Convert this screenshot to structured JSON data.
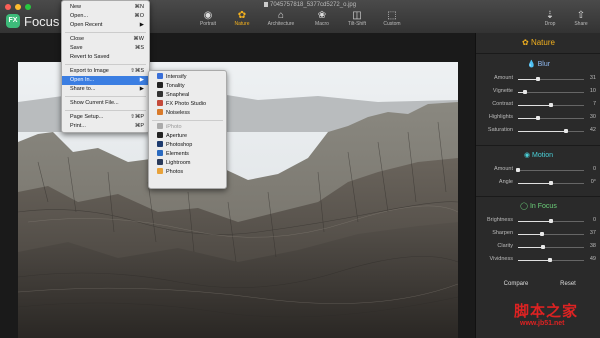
{
  "window": {
    "traffic_lights": [
      "#fc5f57",
      "#fdbc2e",
      "#28c840"
    ],
    "app_name": "Focus",
    "logo_text": "FX",
    "document_title": "7045757818_5377cd5272_o.jpg"
  },
  "toolbar": {
    "presets": [
      {
        "label": "Portrait",
        "icon": "portrait-icon",
        "glyph": "◉"
      },
      {
        "label": "Nature",
        "icon": "nature-icon",
        "glyph": "✿",
        "active": true
      },
      {
        "label": "Architecture",
        "icon": "architecture-icon",
        "glyph": "⌂"
      },
      {
        "label": "Macro",
        "icon": "macro-icon",
        "glyph": "❀"
      },
      {
        "label": "Tilt-Shift",
        "icon": "tilt-shift-icon",
        "glyph": "◫"
      },
      {
        "label": "Custom",
        "icon": "custom-icon",
        "glyph": "⬚"
      }
    ],
    "right": [
      {
        "label": "Drop",
        "icon": "drop-icon",
        "glyph": "⇣"
      },
      {
        "label": "Share",
        "icon": "share-icon",
        "glyph": "⇧"
      }
    ]
  },
  "file_menu": {
    "items": [
      {
        "label": "New",
        "shortcut": "⌘N"
      },
      {
        "label": "Open...",
        "shortcut": "⌘O"
      },
      {
        "label": "Open Recent",
        "shortcut": "▶"
      },
      {
        "sep": true
      },
      {
        "label": "Close",
        "shortcut": "⌘W"
      },
      {
        "label": "Save",
        "shortcut": "⌘S"
      },
      {
        "label": "Revert to Saved",
        "shortcut": ""
      },
      {
        "sep": true
      },
      {
        "label": "Export to Image",
        "shortcut": "⇧⌘S"
      },
      {
        "label": "Open In...",
        "shortcut": "▶",
        "highlighted": true
      },
      {
        "label": "Share to...",
        "shortcut": "▶"
      },
      {
        "sep": true
      },
      {
        "label": "Show Current File...",
        "shortcut": ""
      },
      {
        "sep": true
      },
      {
        "label": "Page Setup...",
        "shortcut": "⇧⌘P"
      },
      {
        "label": "Print...",
        "shortcut": "⌘P"
      }
    ]
  },
  "open_in_menu": {
    "items": [
      {
        "label": "Intensify",
        "color": "#3a6fd8"
      },
      {
        "label": "Tonality",
        "color": "#222222"
      },
      {
        "label": "Snapheal",
        "color": "#333333"
      },
      {
        "label": "FX Photo Studio",
        "color": "#c44a3a"
      },
      {
        "label": "Noiseless",
        "color": "#d97a2a"
      },
      {
        "sep": true
      },
      {
        "label": "iPhoto",
        "color": "#aaaaaa",
        "disabled": true
      },
      {
        "label": "Aperture",
        "color": "#222222"
      },
      {
        "label": "Photoshop",
        "color": "#1d3b6e"
      },
      {
        "label": "Elements",
        "color": "#2a6ac0"
      },
      {
        "label": "Lightroom",
        "color": "#2a3a5a"
      },
      {
        "label": "Photos",
        "color": "#e8a23a"
      }
    ]
  },
  "sidebar": {
    "title": "Nature",
    "sections": [
      {
        "title": "Blur",
        "color": "#8fb8f0",
        "icon": "droplet-icon",
        "glyph": "💧",
        "rows": [
          {
            "label": "Amount",
            "value": "31",
            "fraction": 0.31
          },
          {
            "label": "Vignette",
            "value": "10",
            "fraction": 0.1
          },
          {
            "label": "Contrast",
            "value": "7",
            "fraction": 0.5
          },
          {
            "label": "Highlights",
            "value": "30",
            "fraction": 0.3
          },
          {
            "label": "Saturation",
            "value": "42",
            "fraction": 0.72
          }
        ]
      },
      {
        "title": "Motion",
        "color": "#4ad0d8",
        "icon": "motion-icon",
        "glyph": "◉",
        "rows": [
          {
            "label": "Amount",
            "value": "0",
            "fraction": 0.0
          },
          {
            "label": "Angle",
            "value": "0°",
            "fraction": 0.5
          }
        ]
      },
      {
        "title": "In Focus",
        "color": "#6cd07a",
        "icon": "focus-icon",
        "glyph": "◯",
        "rows": [
          {
            "label": "Brightness",
            "value": "0",
            "fraction": 0.5
          },
          {
            "label": "Sharpen",
            "value": "37",
            "fraction": 0.37
          },
          {
            "label": "Clarity",
            "value": "38",
            "fraction": 0.38
          },
          {
            "label": "Vividness",
            "value": "49",
            "fraction": 0.49
          }
        ]
      }
    ],
    "buttons": [
      "Compare",
      "Reset"
    ]
  },
  "watermark": {
    "text": "脚本之家",
    "url": "www.jb51.net"
  }
}
